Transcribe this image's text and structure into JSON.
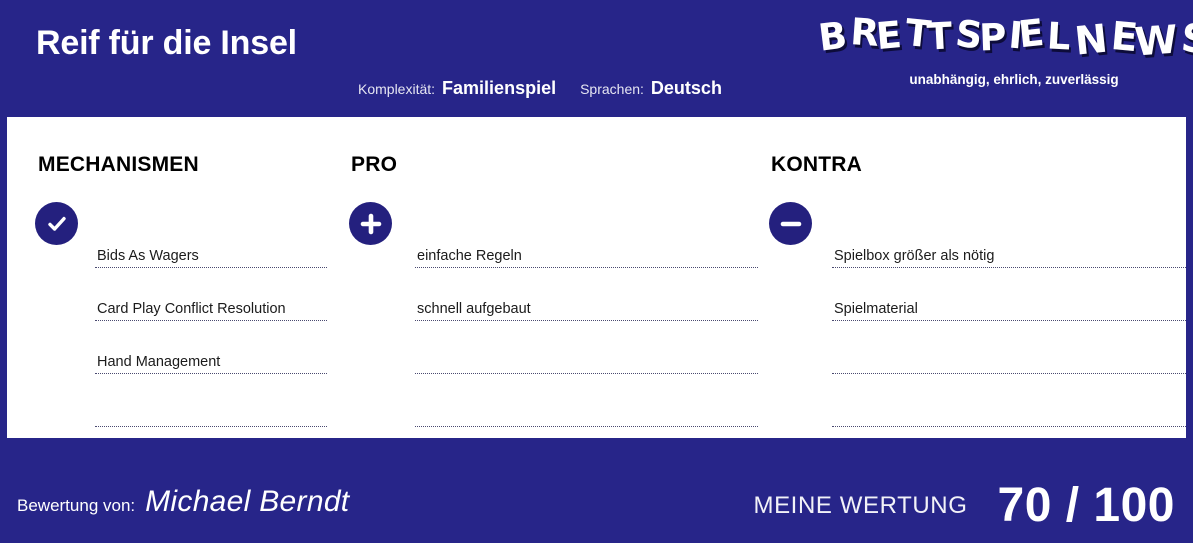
{
  "header": {
    "game_title": "Reif für die Insel",
    "meta": [
      {
        "label": "Komplexität:",
        "value": "Familienspiel"
      },
      {
        "label": "Sprachen:",
        "value": "Deutsch"
      }
    ],
    "logo": {
      "word1": "BRETTSPIEL",
      "word2": "NEWS",
      "tagline": "unabhängig, ehrlich, zuverlässig"
    }
  },
  "columns": [
    {
      "id": "mechanismen",
      "heading": "MECHANISMEN",
      "icon": "check-circle-icon",
      "entries": [
        "Bids As Wagers",
        "Card Play Conflict Resolution",
        "Hand Management",
        ""
      ]
    },
    {
      "id": "pro",
      "heading": "PRO",
      "icon": "plus-circle-icon",
      "entries": [
        "einfache Regeln",
        "schnell aufgebaut",
        "",
        ""
      ]
    },
    {
      "id": "kontra",
      "heading": "KONTRA",
      "icon": "minus-circle-icon",
      "entries": [
        "Spielbox größer als nötig",
        "Spielmaterial",
        "",
        ""
      ]
    }
  ],
  "footer": {
    "rated_by_label": "Bewertung von:",
    "reviewer": "Michael Berndt",
    "score_label": "MEINE WERTUNG",
    "score_value": "70 / 100"
  },
  "colors": {
    "brand_blue": "#272589",
    "icon_blue": "#24207e",
    "card_bg": "#ffffff",
    "text_dark": "#1b1b1b"
  }
}
